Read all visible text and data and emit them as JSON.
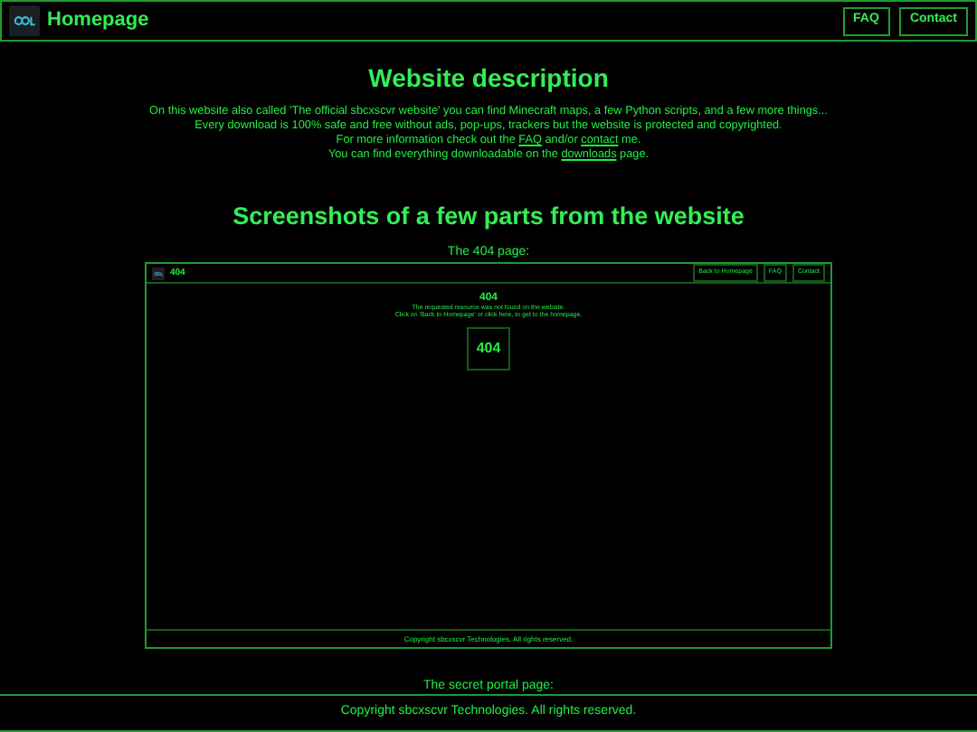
{
  "header": {
    "title": "Homepage",
    "nav": [
      "FAQ",
      "Contact"
    ]
  },
  "description": {
    "heading": "Website description",
    "lines": [
      {
        "parts": [
          {
            "text": "On this website also called 'The official sbcxscvr website' you can find Minecraft maps, a few Python scripts, and a few more things..."
          }
        ]
      },
      {
        "parts": [
          {
            "text": "Every download is 100% safe and free without ads, pop-ups, trackers but the website is protected and copyrighted."
          }
        ]
      },
      {
        "parts": [
          {
            "text": "For more information check out the "
          },
          {
            "text": "FAQ",
            "link": true
          },
          {
            "text": " and/or "
          },
          {
            "text": "contact",
            "link": true
          },
          {
            "text": " me."
          }
        ]
      },
      {
        "parts": [
          {
            "text": "You can find everything downloadable on the "
          },
          {
            "text": "downloads",
            "link": true
          },
          {
            "text": " page."
          }
        ]
      }
    ]
  },
  "screenshots": {
    "heading": "Screenshots of a few parts from the website",
    "items": [
      {
        "caption": "The 404 page:",
        "screen": {
          "title": "404",
          "nav": [
            "Back to Homepage",
            "FAQ",
            "Contact"
          ],
          "heading": "404",
          "lines": [
            "The requested resource was not found on the website.",
            "Click on 'Back to Homepage' or click here, to get to the homepage."
          ],
          "badge": "404",
          "footer": "Copyright sbcxscvr Technologies. All rights reserved."
        }
      },
      {
        "caption": "The secret portal page:"
      }
    ]
  },
  "footer": {
    "text": "Copyright sbcxscvr Technologies. All rights reserved."
  }
}
